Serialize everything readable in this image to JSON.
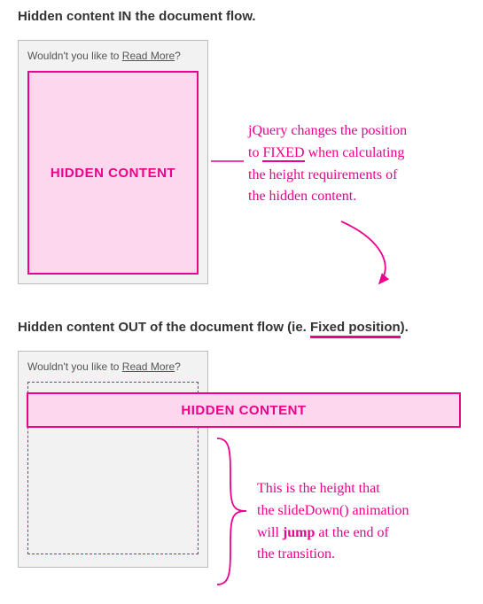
{
  "section1": {
    "heading_pre": "Hidden content ",
    "heading_em": "IN",
    "heading_post": " the document flow."
  },
  "section2": {
    "heading_pre": "Hidden content ",
    "heading_em": "OUT",
    "heading_mid": " of the document flow (ie. ",
    "heading_underlined": "Fixed position",
    "heading_post": ")."
  },
  "prompt": {
    "pre": "Wouldn't you like to ",
    "link": "Read More",
    "post": "?"
  },
  "content_label": "HIDDEN CONTENT",
  "note1": {
    "l1": "jQuery changes the position",
    "l2_pre": "to ",
    "l2_em": "FIXED",
    "l2_post": " when calculating",
    "l3": "the height requirements of",
    "l4": "the hidden content."
  },
  "note2": {
    "l1": "This is the height that",
    "l2": "the slideDown() animation",
    "l3_pre": "will ",
    "l3_em": "jump",
    "l3_post": " at the end of",
    "l4": "the transition."
  },
  "colors": {
    "accent": "#ec008c"
  }
}
